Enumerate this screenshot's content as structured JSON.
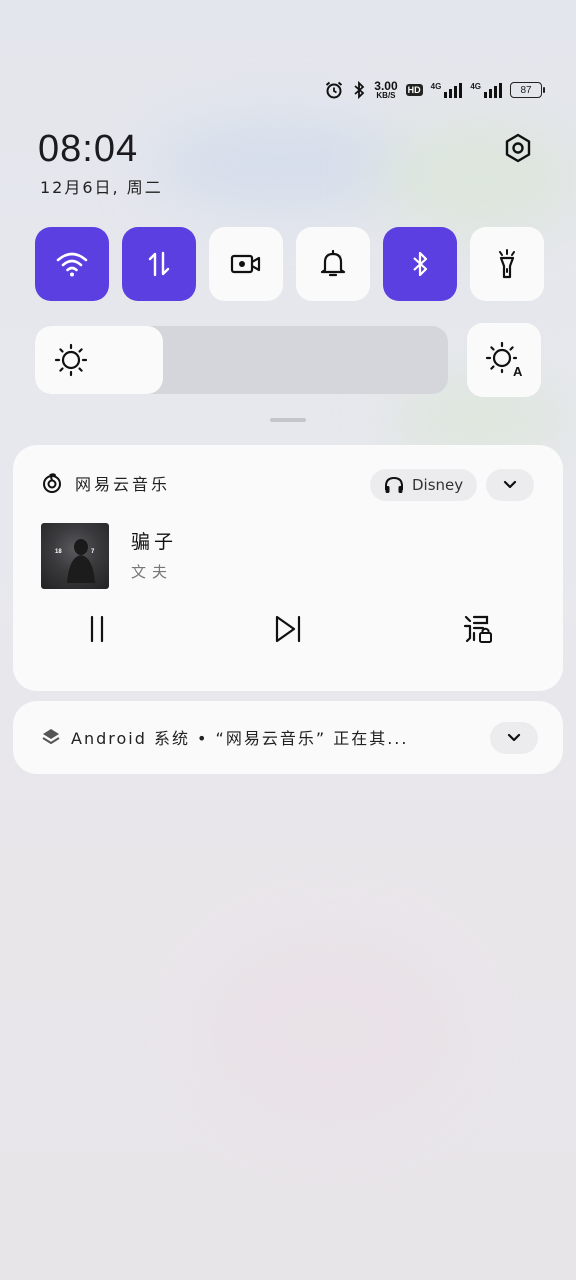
{
  "status_bar": {
    "speed_value": "3.00",
    "speed_unit": "KB/S",
    "hd_badge": "HD",
    "network_1": "4G",
    "network_2": "4G",
    "battery": "87",
    "icons": [
      "alarm-icon",
      "bluetooth-icon",
      "hd-icon",
      "signal-icon",
      "signal-icon",
      "battery-icon"
    ]
  },
  "header": {
    "time": "08:04",
    "date": "12月6日, 周二"
  },
  "quick_tiles": [
    {
      "name": "wifi",
      "icon": "wifi-icon",
      "active": true
    },
    {
      "name": "mobile-data",
      "icon": "data-arrows-icon",
      "active": true
    },
    {
      "name": "screen-record",
      "icon": "video-camera-icon",
      "active": false
    },
    {
      "name": "sound",
      "icon": "bell-icon",
      "active": false
    },
    {
      "name": "bluetooth",
      "icon": "bluetooth-icon",
      "active": true
    },
    {
      "name": "flashlight",
      "icon": "flashlight-icon",
      "active": false
    }
  ],
  "brightness": {
    "level": 0.31,
    "auto_icon": "auto-brightness-icon"
  },
  "media_card": {
    "app_name": "网易云音乐",
    "output_device": "Disney",
    "song_title": "骗子",
    "artist": "文夫",
    "cover_text_left": "18",
    "cover_text_right": "7"
  },
  "system_notification": {
    "text": "Android 系统 • “网易云音乐” 正在其..."
  },
  "colors": {
    "accent": "#5b3fe0",
    "tile_off": "#fafafa",
    "card": "#fafafa"
  }
}
